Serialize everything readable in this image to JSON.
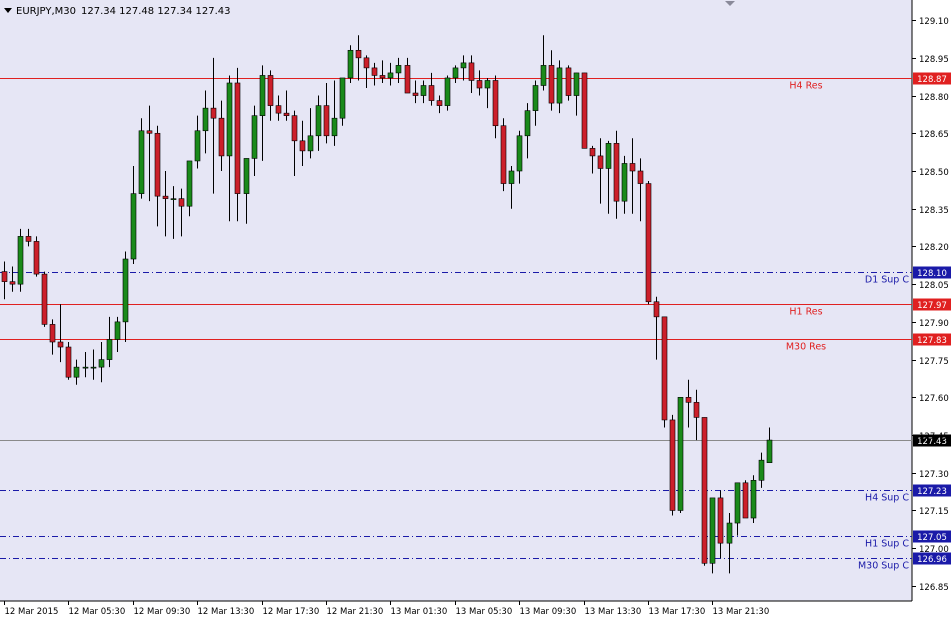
{
  "header": {
    "symbol_timeframe": "EURJPY,M30",
    "ohlc_text": "127.34 127.48 127.34 127.43"
  },
  "colors": {
    "background": "#e6e6f5",
    "axis_background": "#ffffff",
    "bull_candle": "#1a8a1a",
    "bear_candle": "#cc1f2a",
    "resistance_line": "#e02020",
    "support_line": "#1a1aa8",
    "price_line": "#8a8a8a",
    "price_label": "#000000"
  },
  "chart_data": {
    "type": "candlestick",
    "symbol": "EURJPY",
    "timeframe": "M30",
    "ylim": [
      126.79,
      129.18
    ],
    "y_ticks": [
      "129.10",
      "128.95",
      "128.80",
      "128.65",
      "128.50",
      "128.35",
      "128.20",
      "128.05",
      "127.90",
      "127.75",
      "127.60",
      "127.45",
      "127.30",
      "127.15",
      "127.00",
      "126.85"
    ],
    "x_labels": [
      {
        "index": 0,
        "label": "12 Mar 2015"
      },
      {
        "index": 8,
        "label": "12 Mar 05:30"
      },
      {
        "index": 16,
        "label": "12 Mar 09:30"
      },
      {
        "index": 24,
        "label": "12 Mar 13:30"
      },
      {
        "index": 32,
        "label": "12 Mar 17:30"
      },
      {
        "index": 40,
        "label": "12 Mar 21:30"
      },
      {
        "index": 48,
        "label": "13 Mar 01:30"
      },
      {
        "index": 56,
        "label": "13 Mar 05:30"
      },
      {
        "index": 64,
        "label": "13 Mar 09:30"
      },
      {
        "index": 72,
        "label": "13 Mar 13:30"
      },
      {
        "index": 80,
        "label": "13 Mar 17:30"
      },
      {
        "index": 88,
        "label": "13 Mar 21:30"
      }
    ],
    "candles": [
      [
        128.1,
        128.14,
        127.99,
        128.06
      ],
      [
        128.06,
        128.12,
        128.02,
        128.05
      ],
      [
        128.05,
        128.27,
        128.02,
        128.24
      ],
      [
        128.24,
        128.27,
        128.2,
        128.22
      ],
      [
        128.22,
        128.24,
        128.08,
        128.09
      ],
      [
        128.09,
        128.1,
        127.88,
        127.89
      ],
      [
        127.89,
        127.91,
        127.77,
        127.82
      ],
      [
        127.82,
        127.97,
        127.74,
        127.8
      ],
      [
        127.8,
        127.82,
        127.67,
        127.68
      ],
      [
        127.68,
        127.75,
        127.65,
        127.72
      ],
      [
        127.72,
        127.78,
        127.68,
        127.72
      ],
      [
        127.72,
        127.79,
        127.67,
        127.72
      ],
      [
        127.72,
        127.82,
        127.66,
        127.75
      ],
      [
        127.75,
        127.92,
        127.72,
        127.83
      ],
      [
        127.83,
        127.92,
        127.78,
        127.9
      ],
      [
        127.9,
        128.18,
        127.82,
        128.15
      ],
      [
        128.15,
        128.52,
        128.13,
        128.41
      ],
      [
        128.41,
        128.71,
        128.39,
        128.66
      ],
      [
        128.66,
        128.76,
        128.38,
        128.65
      ],
      [
        128.65,
        128.68,
        128.28,
        128.4
      ],
      [
        128.4,
        128.5,
        128.24,
        128.39
      ],
      [
        128.39,
        128.44,
        128.23,
        128.39
      ],
      [
        128.39,
        128.43,
        128.24,
        128.36
      ],
      [
        128.36,
        128.53,
        128.32,
        128.54
      ],
      [
        128.54,
        128.72,
        128.51,
        128.66
      ],
      [
        128.66,
        128.82,
        128.57,
        128.75
      ],
      [
        128.75,
        128.95,
        128.41,
        128.71
      ],
      [
        128.71,
        128.78,
        128.5,
        128.56
      ],
      [
        128.56,
        128.88,
        128.3,
        128.85
      ],
      [
        128.85,
        128.91,
        128.3,
        128.41
      ],
      [
        128.41,
        128.55,
        128.29,
        128.55
      ],
      [
        128.55,
        128.76,
        128.48,
        128.72
      ],
      [
        128.72,
        128.92,
        128.54,
        128.88
      ],
      [
        128.88,
        128.9,
        128.7,
        128.76
      ],
      [
        128.76,
        128.8,
        128.7,
        128.73
      ],
      [
        128.73,
        128.82,
        128.7,
        128.72
      ],
      [
        128.72,
        128.74,
        128.48,
        128.62
      ],
      [
        128.62,
        128.7,
        128.52,
        128.58
      ],
      [
        128.58,
        128.75,
        128.55,
        128.64
      ],
      [
        128.64,
        128.8,
        128.58,
        128.76
      ],
      [
        128.76,
        128.85,
        128.61,
        128.64
      ],
      [
        128.64,
        128.86,
        128.6,
        128.71
      ],
      [
        128.71,
        128.85,
        128.68,
        128.87
      ],
      [
        128.87,
        129.0,
        128.85,
        128.98
      ],
      [
        128.98,
        129.04,
        128.86,
        128.95
      ],
      [
        128.95,
        128.96,
        128.83,
        128.91
      ],
      [
        128.91,
        128.93,
        128.84,
        128.88
      ],
      [
        128.88,
        128.94,
        128.85,
        128.87
      ],
      [
        128.87,
        128.93,
        128.84,
        128.89
      ],
      [
        128.89,
        128.95,
        128.85,
        128.92
      ],
      [
        128.92,
        128.95,
        128.81,
        128.81
      ],
      [
        128.81,
        128.86,
        128.77,
        128.8
      ],
      [
        128.8,
        128.86,
        128.77,
        128.84
      ],
      [
        128.84,
        128.89,
        128.76,
        128.78
      ],
      [
        128.78,
        128.8,
        128.73,
        128.76
      ],
      [
        128.76,
        128.88,
        128.74,
        128.87
      ],
      [
        128.87,
        128.92,
        128.85,
        128.91
      ],
      [
        128.91,
        128.96,
        128.86,
        128.93
      ],
      [
        128.93,
        128.96,
        128.81,
        128.86
      ],
      [
        128.86,
        128.9,
        128.8,
        128.83
      ],
      [
        128.83,
        128.87,
        128.75,
        128.86
      ],
      [
        128.86,
        128.88,
        128.63,
        128.68
      ],
      [
        128.68,
        128.71,
        128.42,
        128.45
      ],
      [
        128.45,
        128.52,
        128.35,
        128.5
      ],
      [
        128.5,
        128.66,
        128.45,
        128.64
      ],
      [
        128.64,
        128.77,
        128.55,
        128.74
      ],
      [
        128.74,
        128.86,
        128.68,
        128.84
      ],
      [
        128.84,
        129.04,
        128.82,
        128.92
      ],
      [
        128.92,
        128.98,
        128.74,
        128.77
      ],
      [
        128.77,
        128.94,
        128.73,
        128.91
      ],
      [
        128.91,
        128.92,
        128.78,
        128.8
      ],
      [
        128.8,
        128.89,
        128.72,
        128.89
      ],
      [
        128.89,
        128.89,
        128.59,
        128.59
      ],
      [
        128.59,
        128.6,
        128.49,
        128.56
      ],
      [
        128.56,
        128.63,
        128.37,
        128.51
      ],
      [
        128.51,
        128.62,
        128.33,
        128.61
      ],
      [
        128.61,
        128.66,
        128.31,
        128.38
      ],
      [
        128.38,
        128.56,
        128.33,
        128.53
      ],
      [
        128.53,
        128.63,
        128.33,
        128.5
      ],
      [
        128.5,
        128.55,
        128.3,
        128.45
      ],
      [
        128.45,
        128.46,
        127.97,
        127.98
      ],
      [
        127.98,
        128.0,
        127.75,
        127.92
      ],
      [
        127.92,
        127.92,
        127.48,
        127.51
      ],
      [
        127.51,
        127.53,
        127.13,
        127.15
      ],
      [
        127.15,
        127.54,
        127.14,
        127.6
      ],
      [
        127.6,
        127.67,
        127.48,
        127.58
      ],
      [
        127.58,
        127.63,
        127.43,
        127.52
      ],
      [
        127.52,
        127.52,
        126.93,
        126.94
      ],
      [
        126.94,
        127.16,
        126.9,
        127.2
      ],
      [
        127.2,
        127.23,
        126.96,
        127.02
      ],
      [
        127.02,
        127.14,
        126.9,
        127.1
      ],
      [
        127.1,
        127.26,
        127.05,
        127.26
      ],
      [
        127.26,
        127.27,
        127.13,
        127.12
      ],
      [
        127.12,
        127.29,
        127.1,
        127.27
      ],
      [
        127.27,
        127.38,
        127.24,
        127.35
      ],
      [
        127.34,
        127.48,
        127.34,
        127.43
      ]
    ],
    "levels": [
      {
        "name": "H4 Res",
        "value": 128.87,
        "label": "128.87",
        "kind": "resistance"
      },
      {
        "name": "D1 Sup C",
        "value": 128.1,
        "label": "128.10",
        "kind": "support"
      },
      {
        "name": "H1 Res",
        "value": 127.97,
        "label": "127.97",
        "kind": "resistance"
      },
      {
        "name": "M30 Res",
        "value": 127.83,
        "label": "127.83",
        "kind": "resistance"
      },
      {
        "name": "",
        "value": 127.43,
        "label": "127.43",
        "kind": "price"
      },
      {
        "name": "H4 Sup C",
        "value": 127.23,
        "label": "127.23",
        "kind": "support"
      },
      {
        "name": "H1 Sup C",
        "value": 127.05,
        "label": "127.05",
        "kind": "support"
      },
      {
        "name": "M30 Sup C",
        "value": 126.96,
        "label": "126.96",
        "kind": "support"
      }
    ]
  }
}
